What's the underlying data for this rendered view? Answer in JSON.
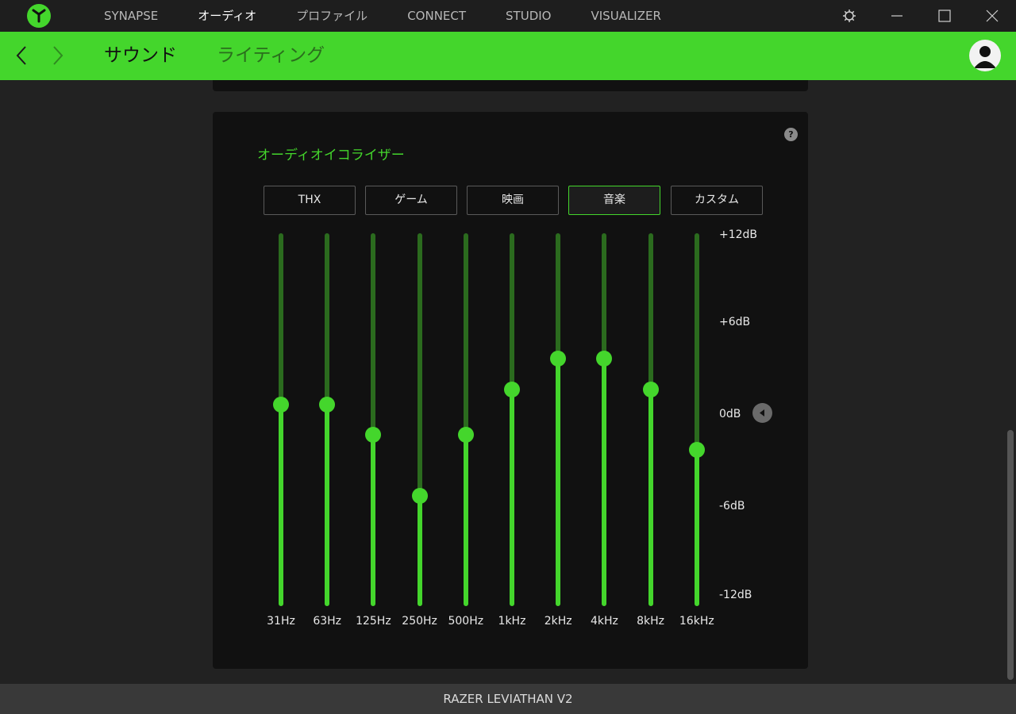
{
  "titlebar": {
    "nav": [
      {
        "label": "SYNAPSE",
        "active": false
      },
      {
        "label": "オーディオ",
        "active": true
      },
      {
        "label": "プロファイル",
        "active": false
      },
      {
        "label": "CONNECT",
        "active": false
      },
      {
        "label": "STUDIO",
        "active": false
      },
      {
        "label": "VISUALIZER",
        "active": false
      }
    ],
    "icons": [
      "razer-logo-icon",
      "settings-gear-icon",
      "minimize-icon",
      "maximize-icon",
      "close-icon"
    ]
  },
  "subheader": {
    "tabs": [
      {
        "label": "サウンド",
        "active": true
      },
      {
        "label": "ライティング",
        "active": false
      }
    ],
    "icons": [
      "back-arrow-icon",
      "forward-arrow-icon",
      "user-avatar-icon"
    ]
  },
  "equalizer": {
    "title": "オーディオイコライザー",
    "help": "?",
    "presets": [
      {
        "label": "THX",
        "active": false
      },
      {
        "label": "ゲーム",
        "active": false
      },
      {
        "label": "映画",
        "active": false
      },
      {
        "label": "音楽",
        "active": true
      },
      {
        "label": "カスタム",
        "active": false
      }
    ],
    "scale": {
      "min": -12,
      "max": 12,
      "unit": "dB"
    },
    "db_labels": [
      "+12dB",
      "+6dB",
      "0dB",
      "-6dB",
      "-12dB"
    ],
    "bands": [
      {
        "freq": "31Hz",
        "gain": 1
      },
      {
        "freq": "63Hz",
        "gain": 1
      },
      {
        "freq": "125Hz",
        "gain": -1
      },
      {
        "freq": "250Hz",
        "gain": -5
      },
      {
        "freq": "500Hz",
        "gain": -1
      },
      {
        "freq": "1kHz",
        "gain": 2
      },
      {
        "freq": "2kHz",
        "gain": 4
      },
      {
        "freq": "4kHz",
        "gain": 4
      },
      {
        "freq": "8kHz",
        "gain": 2
      },
      {
        "freq": "16kHz",
        "gain": -2
      }
    ],
    "colors": {
      "accent": "#44d62c",
      "track_inactive": "#2b6b1e"
    }
  },
  "footer": {
    "device": "RAZER LEVIATHAN V2"
  }
}
